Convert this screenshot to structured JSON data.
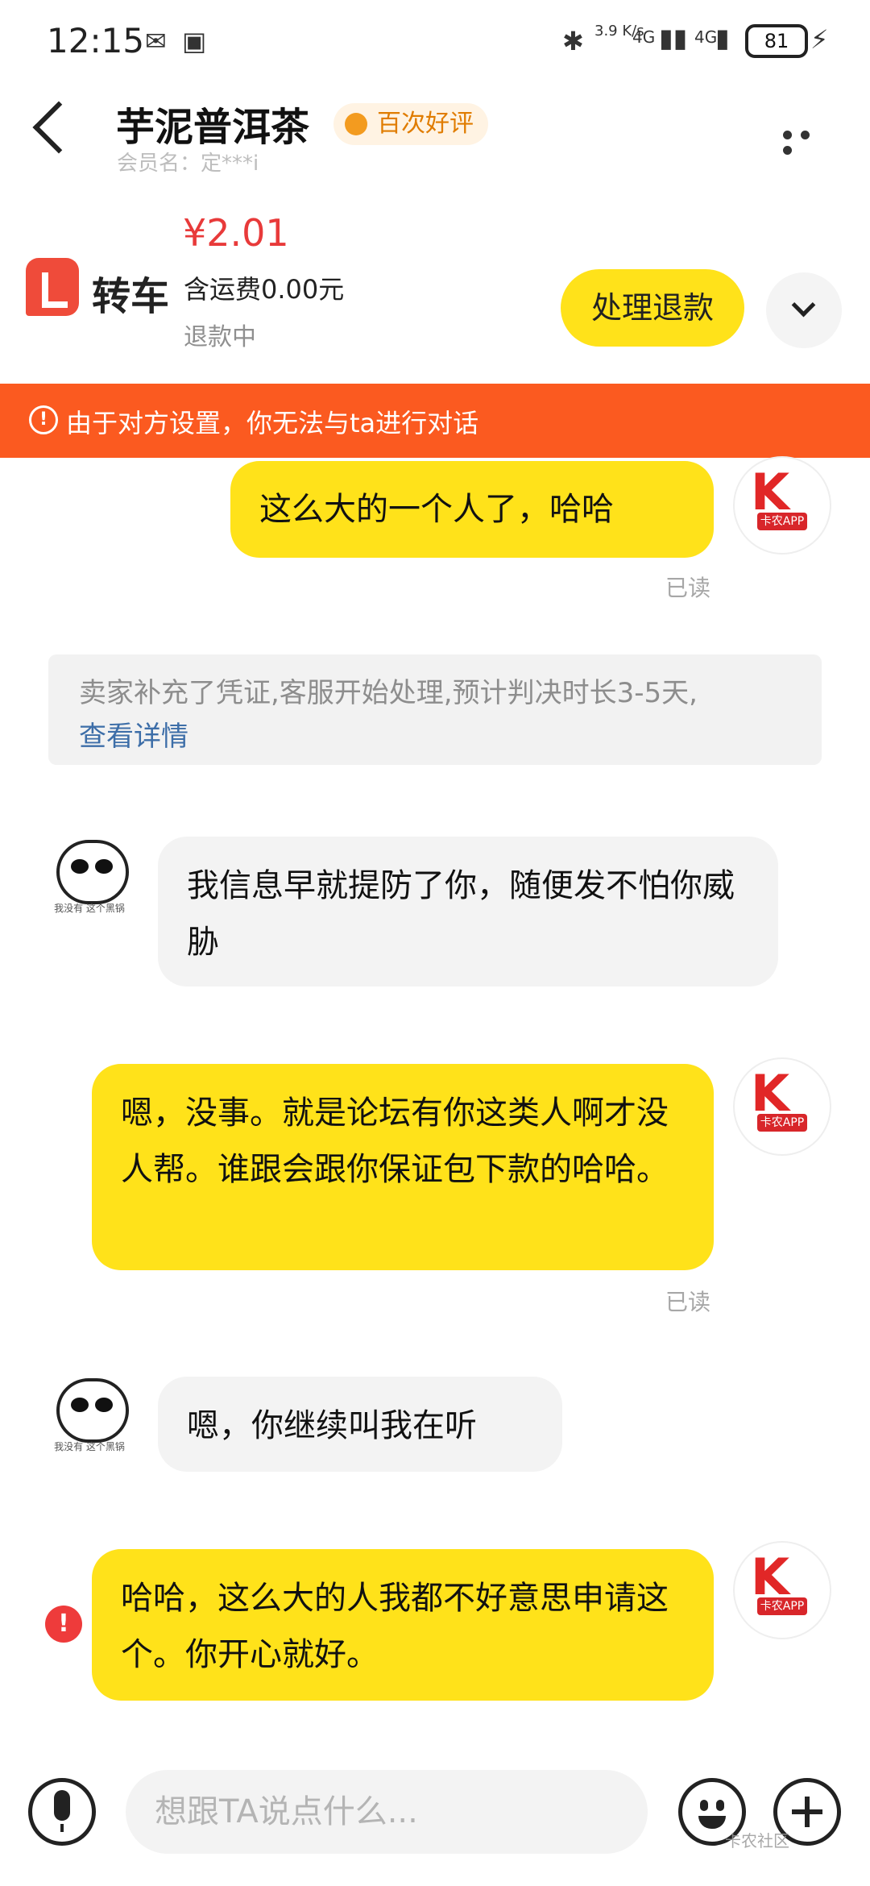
{
  "status_bar": {
    "time": "12:15",
    "net_speed": "3.9 K/s",
    "signal1": "4G",
    "signal2": "4G",
    "battery": "81"
  },
  "header": {
    "title": "芋泥普洱茶",
    "badge": "百次好评",
    "member_name": "会员名：定***i"
  },
  "product": {
    "logo_text": "转车",
    "price": "¥2.01",
    "shipping": "含运费0.00元",
    "status": "退款中",
    "action_label": "处理退款"
  },
  "banner": {
    "text": "由于对方设置，你无法与ta进行对话"
  },
  "messages": [
    {
      "from": "me",
      "text": "这么大的一个人了，哈哈",
      "status": "已读"
    },
    {
      "from": "system",
      "text": "卖家补充了凭证,客服开始处理,预计判决时长3-5天,",
      "link": "查看详情"
    },
    {
      "from": "them",
      "text": "我信息早就提防了你，随便发不怕你威胁"
    },
    {
      "from": "me",
      "text": "嗯，没事。就是论坛有你这类人啊才没人帮。谁跟会跟你保证包下款的哈哈。",
      "status": "已读"
    },
    {
      "from": "them",
      "text": "嗯，你继续叫我在听"
    },
    {
      "from": "me",
      "text": "哈哈，这么大的人我都不好意思申请这个。你开心就好。",
      "failed": true
    }
  ],
  "avatars": {
    "me_label": "卡农APP",
    "them_caption": "我没有 这个黑锅"
  },
  "input": {
    "placeholder": "想跟TA说点什么..."
  },
  "watermark": "卡农社区",
  "colors": {
    "accent_yellow": "#ffe21a",
    "banner_orange": "#fb5a20",
    "price_red": "#e83a3a",
    "link_blue": "#3d6ea8"
  }
}
